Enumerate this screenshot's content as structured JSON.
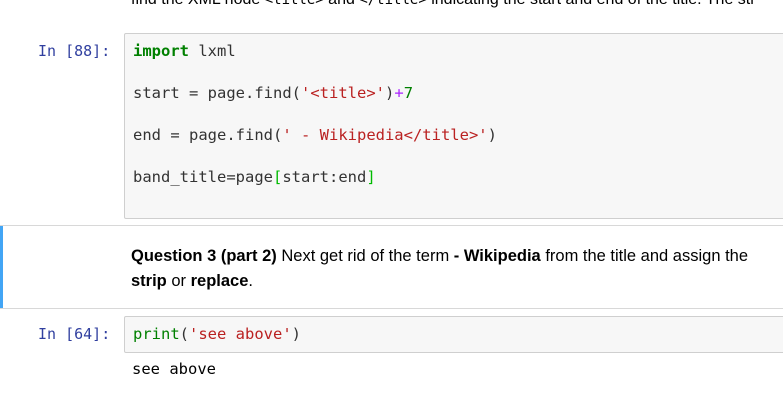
{
  "top_markdown": {
    "text_before": "find the XML node ",
    "code1": "<title>",
    "text_mid": " and ",
    "code2": "</title>",
    "text_after": " indicating the start and end of the title. The str"
  },
  "cells": [
    {
      "prompt": "In [88]:",
      "lines": [
        {
          "tokens": [
            {
              "t": "import",
              "c": "kw"
            },
            {
              "t": " lxml",
              "c": "plain"
            }
          ]
        },
        {
          "tokens": [
            {
              "t": "start ",
              "c": "plain"
            },
            {
              "t": "=",
              "c": "plain"
            },
            {
              "t": " page.find(",
              "c": "plain"
            },
            {
              "t": "'<title>'",
              "c": "str"
            },
            {
              "t": ")",
              "c": "plain"
            },
            {
              "t": "+",
              "c": "op"
            },
            {
              "t": "7",
              "c": "num"
            }
          ]
        },
        {
          "tokens": [
            {
              "t": "end ",
              "c": "plain"
            },
            {
              "t": "=",
              "c": "plain"
            },
            {
              "t": " page.find(",
              "c": "plain"
            },
            {
              "t": "' - Wikipedia</title>'",
              "c": "str"
            },
            {
              "t": ")",
              "c": "plain"
            }
          ]
        },
        {
          "tokens": [
            {
              "t": "band_title",
              "c": "plain"
            },
            {
              "t": "=",
              "c": "plain"
            },
            {
              "t": "page",
              "c": "plain"
            },
            {
              "t": "[",
              "c": "bracket-hl"
            },
            {
              "t": "start:end",
              "c": "plain"
            },
            {
              "t": "]",
              "c": "bracket-hl"
            }
          ]
        }
      ]
    },
    {
      "prompt": "In [64]:",
      "lines": [
        {
          "tokens": [
            {
              "t": "print",
              "c": "fn"
            },
            {
              "t": "(",
              "c": "plain"
            },
            {
              "t": "'see above'",
              "c": "str"
            },
            {
              "t": ")",
              "c": "plain"
            }
          ]
        }
      ],
      "output": "see above"
    }
  ],
  "markdown": {
    "q_label": "Question 3 (part 2)",
    "t1": " Next get rid of the term ",
    "term": "- Wikipedia",
    "t2": " from the title and assign the",
    "strip": "strip",
    "t3": " or ",
    "replace": "replace",
    "t4": "."
  },
  "colors": {
    "prompt": "#303f9f",
    "selected_bar": "#42a5f5",
    "keyword": "#008000",
    "string": "#ba2121"
  }
}
